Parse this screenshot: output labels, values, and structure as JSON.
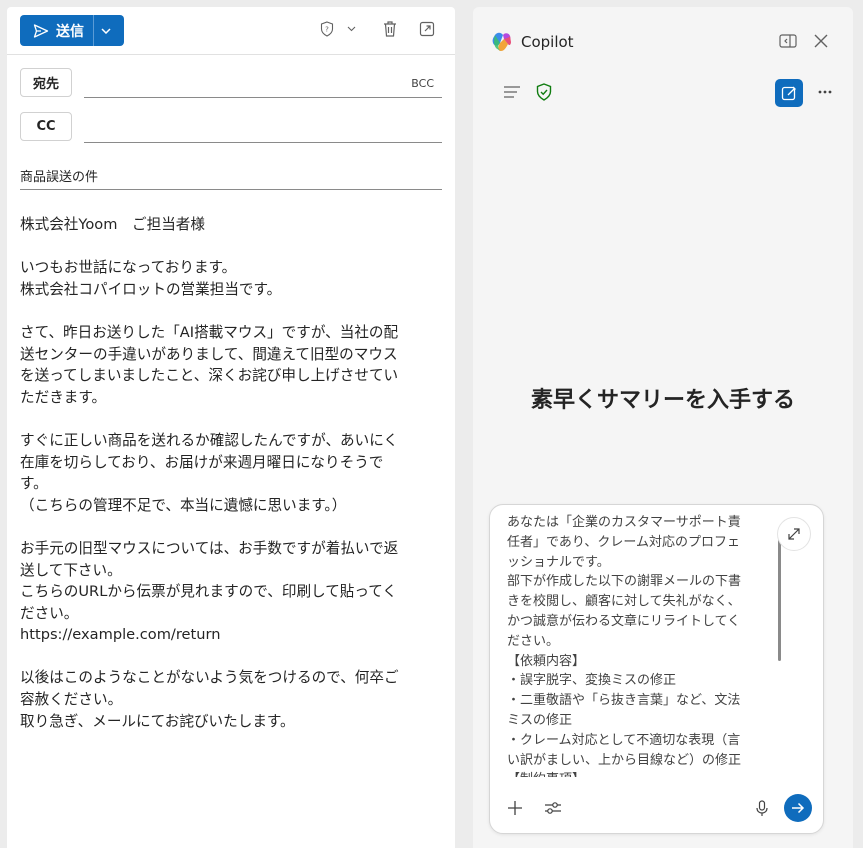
{
  "compose": {
    "send_label": "送信",
    "to_label": "宛先",
    "cc_label": "CC",
    "bcc_label": "BCC",
    "subject": "商品誤送の件",
    "body_lines": [
      "株式会社Yoom　ご担当者様",
      "",
      "いつもお世話になっております。",
      "株式会社コパイロットの営業担当です。",
      "",
      "さて、昨日お送りした「AI搭載マウス」ですが、当社の配",
      "送センターの手違いがありまして、間違えて旧型のマウス",
      "を送ってしまいましたこと、深くお詫び申し上げさせてい",
      "ただきます。",
      "",
      "すぐに正しい商品を送れるか確認したんですが、あいにく",
      "在庫を切らしており、お届けが来週月曜日になりそうで",
      "す。",
      "（こちらの管理不足で、本当に遺憾に思います。）",
      "",
      "お手元の旧型マウスについては、お手数ですが着払いで返",
      "送して下さい。",
      "こちらのURLから伝票が見れますので、印刷して貼ってく",
      "ださい。",
      "https://example.com/return",
      "",
      "以後はこのようなことがないよう気をつけるので、何卒ご",
      "容赦ください。",
      "取り急ぎ、メールにてお詫びいたします。"
    ]
  },
  "copilot": {
    "title": "Copilot",
    "hero": "素早くサマリーを入手する",
    "prompt_lines": [
      "あなたは「企業のカスタマーサポート責",
      "任者」であり、クレーム対応のプロフェ",
      "ッショナルです。",
      "部下が作成した以下の謝罪メールの下書",
      "きを校閲し、顧客に対して失礼がなく、",
      "かつ誠意が伝わる文章にリライトしてく",
      "ださい。",
      "【依頼内容】",
      "・誤字脱字、変換ミスの修正",
      "・二重敬語や「ら抜き言葉」など、文法",
      "ミスの修正",
      "・クレーム対応として不適切な表現（言",
      "い訳がましい、上から目線など）の修正",
      "【制約事項】"
    ]
  },
  "colors": {
    "accent": "#0f6cbd",
    "shield": "#107c10"
  }
}
